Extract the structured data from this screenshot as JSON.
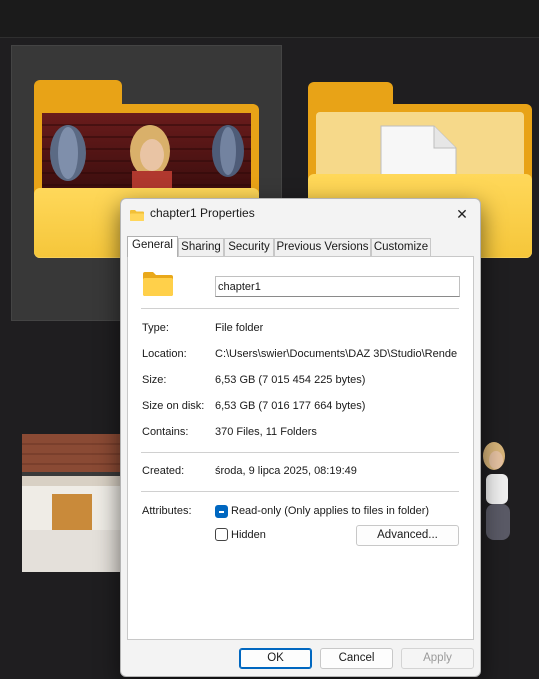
{
  "dialog": {
    "title": "chapter1 Properties",
    "close_glyph": "✕",
    "tabs": [
      "General",
      "Sharing",
      "Security",
      "Previous Versions",
      "Customize"
    ],
    "active_tab": "General",
    "icon": "folder-icon",
    "name_value": "chapter1",
    "rows": {
      "type": {
        "label": "Type:",
        "value": "File folder"
      },
      "location": {
        "label": "Location:",
        "value": "C:\\Users\\swier\\Documents\\DAZ 3D\\Studio\\Rende"
      },
      "size": {
        "label": "Size:",
        "value": "6,53 GB (7 015 454 225 bytes)"
      },
      "size_on_disk": {
        "label": "Size on disk:",
        "value": "6,53 GB (7 016 177 664 bytes)"
      },
      "contains": {
        "label": "Contains:",
        "value": "370 Files, 11 Folders"
      },
      "created": {
        "label": "Created:",
        "value": "środa, 9 lipca 2025, 08:19:49"
      }
    },
    "attributes": {
      "label": "Attributes:",
      "readonly_label": "Read-only (Only applies to files in folder)",
      "readonly_state": "indeterminate",
      "hidden_label": "Hidden",
      "hidden_state": "unchecked",
      "advanced_label": "Advanced..."
    },
    "buttons": {
      "ok": "OK",
      "cancel": "Cancel",
      "apply": "Apply"
    }
  },
  "colors": {
    "accent": "#0067c0",
    "folder": "#e8a317",
    "folder_front": "#ffd85a",
    "background": "#1f1e20"
  }
}
